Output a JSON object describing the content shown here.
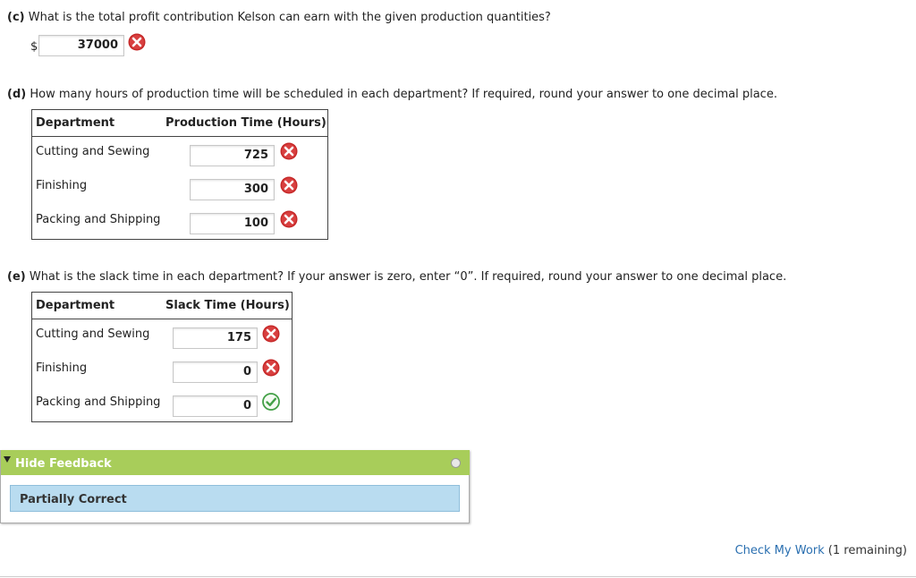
{
  "part_c": {
    "tag": "(c)",
    "question": "What is the total profit contribution Kelson can earn with the given production quantities?",
    "currency": "$",
    "answer": "37000",
    "status": "incorrect"
  },
  "part_d": {
    "tag": "(d)",
    "question": "How many hours of production time will be scheduled in each department? If required, round your answer to one decimal place.",
    "col_department": "Department",
    "col_value": "Production Time (Hours)",
    "rows": [
      {
        "department": "Cutting and Sewing",
        "value": "725",
        "status": "incorrect"
      },
      {
        "department": "Finishing",
        "value": "300",
        "status": "incorrect"
      },
      {
        "department": "Packing and Shipping",
        "value": "100",
        "status": "incorrect"
      }
    ]
  },
  "part_e": {
    "tag": "(e)",
    "question": "What is the slack time in each department? If your answer is zero, enter “0”. If required, round your answer to one decimal place.",
    "col_department": "Department",
    "col_value": "Slack Time (Hours)",
    "rows": [
      {
        "department": "Cutting and Sewing",
        "value": "175",
        "status": "incorrect"
      },
      {
        "department": "Finishing",
        "value": "0",
        "status": "incorrect"
      },
      {
        "department": "Packing and Shipping",
        "value": "0",
        "status": "correct"
      }
    ]
  },
  "feedback": {
    "toggle_label": "Hide Feedback",
    "message": "Partially Correct"
  },
  "check_work": {
    "link_label": "Check My Work",
    "remaining": "(1 remaining)"
  },
  "colors": {
    "incorrect": "#c62828",
    "correct": "#43a047",
    "feedback_header": "#a8cd5a",
    "feedback_box": "#b9dcf0"
  }
}
